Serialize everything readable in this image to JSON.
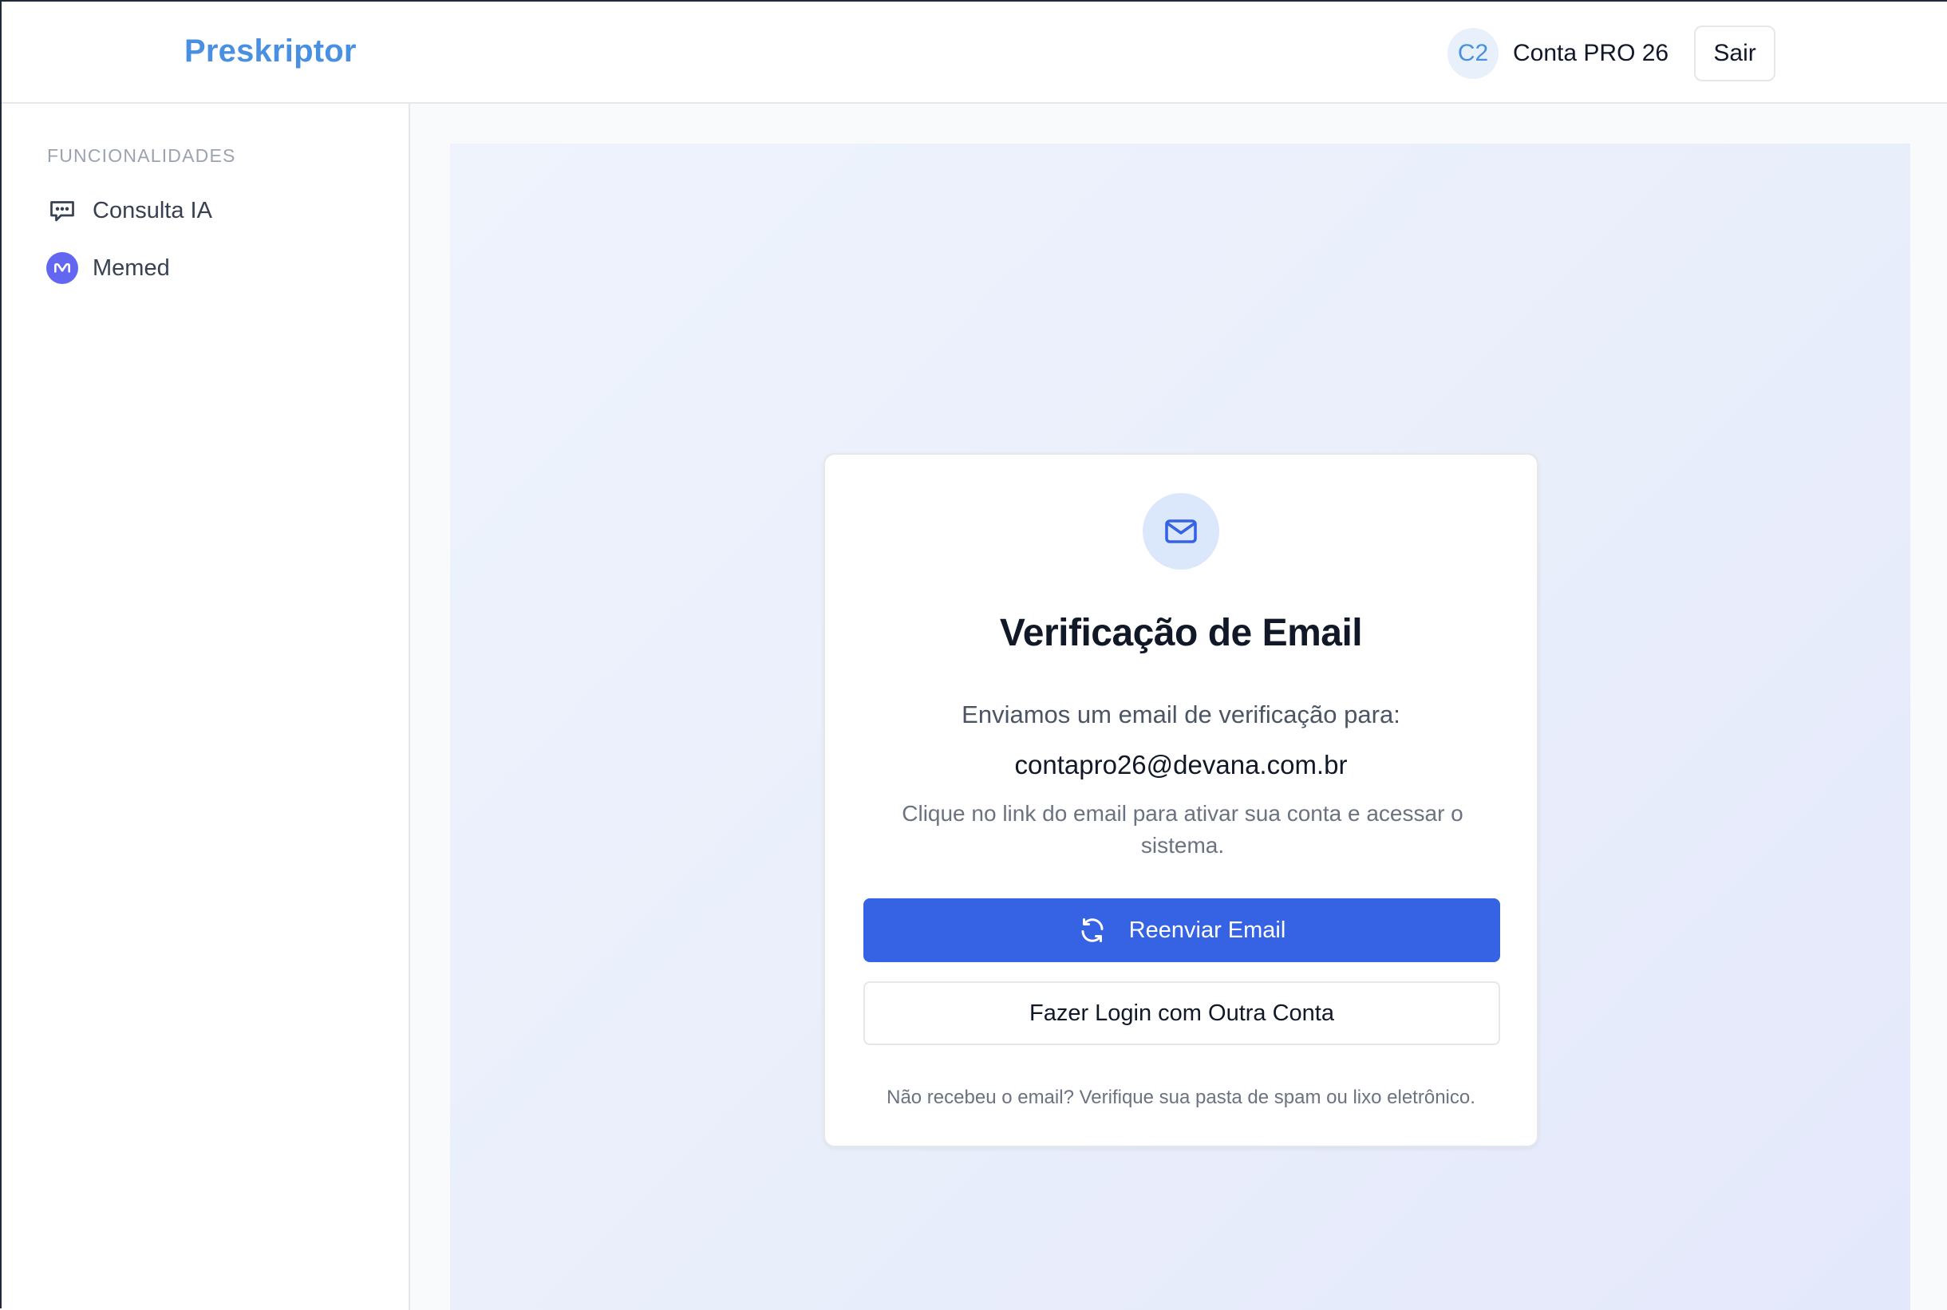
{
  "header": {
    "brand": "Preskriptor",
    "user": {
      "initials": "C2",
      "name": "Conta PRO 26"
    },
    "logout_label": "Sair"
  },
  "sidebar": {
    "heading": "FUNCIONALIDADES",
    "items": [
      {
        "label": "Consulta IA",
        "icon": "chat-bubble-icon"
      },
      {
        "label": "Memed",
        "icon": "memed-logo-icon"
      }
    ]
  },
  "card": {
    "icon": "mail-icon",
    "title": "Verificação de Email",
    "sent_text": "Enviamos um email de verificação para:",
    "email": "contapro26@devana.com.br",
    "hint": "Clique no link do email para ativar sua conta e acessar o sistema.",
    "resend_label": "Reenviar Email",
    "resend_icon": "refresh-icon",
    "other_account_label": "Fazer Login com Outra Conta",
    "footer_note": "Não recebeu o email? Verifique sua pasta de spam ou lixo eletrônico."
  },
  "colors": {
    "brand": "#4a90e2",
    "primary_button": "#3563e3",
    "memed": "#6366f1"
  }
}
